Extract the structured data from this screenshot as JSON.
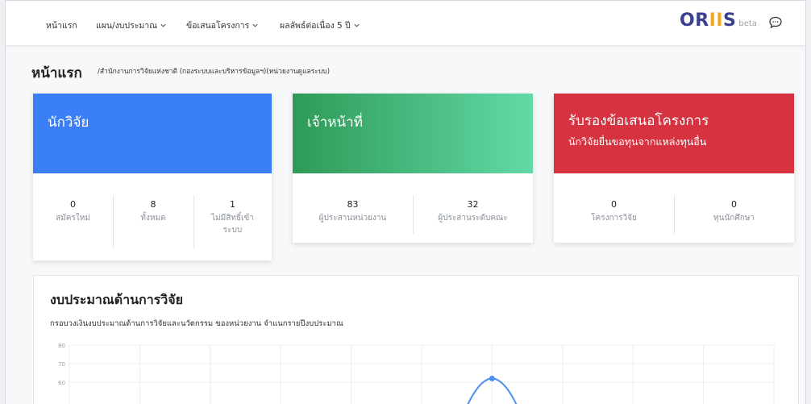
{
  "nav": {
    "items": [
      {
        "label": "หน้าแรก",
        "dropdown": false
      },
      {
        "label": "แผน/งบประมาณ",
        "dropdown": true
      },
      {
        "label": "ข้อเสนอโครงการ",
        "dropdown": true
      },
      {
        "label": "ผลลัพธ์ต่อเนื่อง 5 ปี",
        "dropdown": true
      }
    ],
    "brand": {
      "o": "O",
      "r": "R",
      "ii": "II",
      "s": "S",
      "beta": "beta"
    },
    "chat_icon": "chat-bubble-icon"
  },
  "page": {
    "title": "หน้าแรก",
    "breadcrumb": "/สำนักงานการวิจัยแห่งชาติ (กองระบบและบริหารข้อมูลฯ)(หน่วยงานดูแลระบบ)"
  },
  "cards": [
    {
      "title": "นักวิจัย",
      "subtitle": "",
      "color": "#3a7ff6",
      "stats": [
        {
          "value": "0",
          "label": "สมัครใหม่"
        },
        {
          "value": "8",
          "label": "ทั้งหมด"
        },
        {
          "value": "1",
          "label": "ไม่มีสิทธิ์เข้า ระบบ"
        }
      ]
    },
    {
      "title": "เจ้าหน้าที่",
      "subtitle": "",
      "color_from": "#2e9a57",
      "color_to": "#62d9a6",
      "stats": [
        {
          "value": "83",
          "label": "ผู้ประสานหน่วยงาน"
        },
        {
          "value": "32",
          "label": "ผู้ประสานระดับคณะ"
        }
      ]
    },
    {
      "title": "รับรองข้อเสนอโครงการ",
      "subtitle": "นักวิจัยยื่นขอทุนจากแหล่งทุนอื่น",
      "color": "#d7323f",
      "stats": [
        {
          "value": "0",
          "label": "โครงการวิจัย"
        },
        {
          "value": "0",
          "label": "ทุนนักศึกษา"
        }
      ]
    }
  ],
  "budget": {
    "title": "งบประมาณด้านการวิจัย",
    "subtitle": "กรอบวงเงินงบประมาณด้านการวิจัยและนวัตกรรม ของหน่วยงาน จำแนกรายปีงบประมาณ"
  },
  "chart_data": {
    "type": "line",
    "title": "",
    "xlabel": "",
    "ylabel": "",
    "y_ticks": [
      "80",
      "70",
      "60"
    ],
    "ylim_visible": [
      55,
      80
    ],
    "grid": true,
    "series": [
      {
        "color": "#4a8ff0",
        "peak_value": 62,
        "peak_category_index": 6
      }
    ],
    "category_count": 10
  }
}
